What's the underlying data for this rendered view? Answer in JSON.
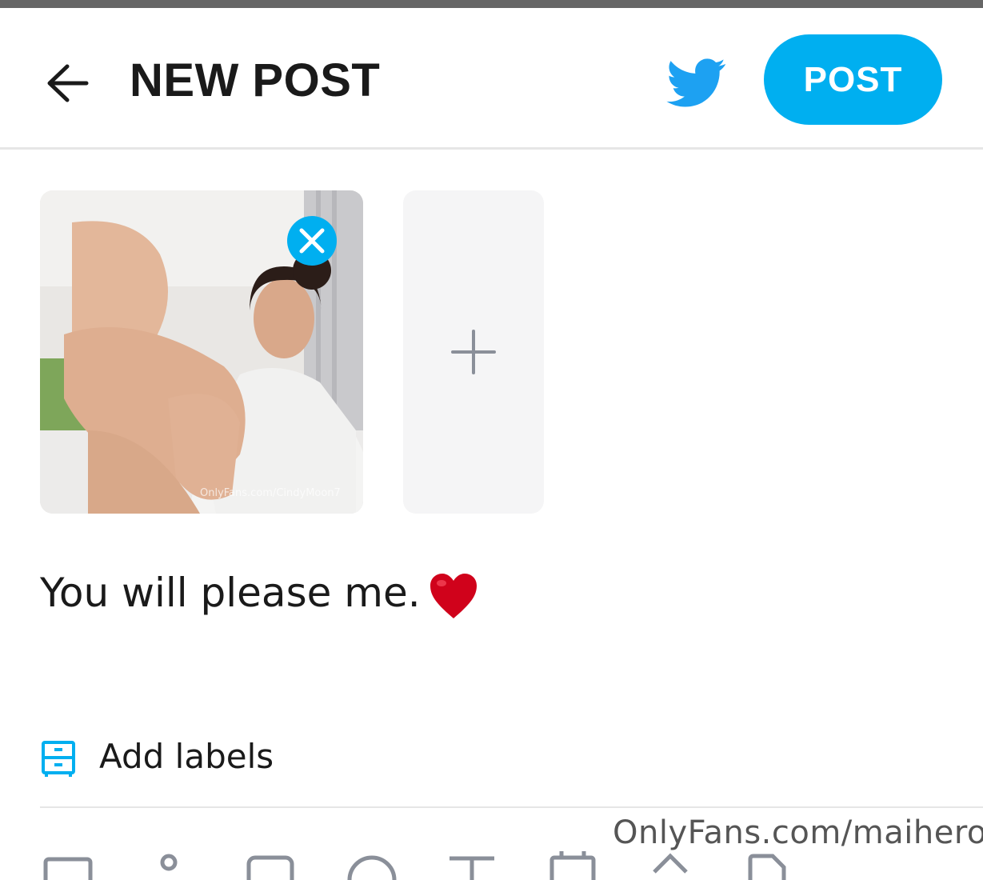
{
  "header": {
    "title": "NEW POST",
    "post_label": "POST"
  },
  "media": {
    "thumbnail_watermark": "OnlyFans.com/CindyMoon7"
  },
  "composer": {
    "text": "You will please me.",
    "emoji": "heart-emoji"
  },
  "labels": {
    "add_label": "Add labels"
  },
  "toolbar": {
    "icons": [
      "image-icon",
      "poll-icon",
      "message-icon",
      "emoji-icon",
      "quiz-icon",
      "calendar-icon",
      "tag-icon",
      "document-icon"
    ]
  },
  "watermark": "OnlyFans.com/maihero",
  "colors": {
    "accent": "#00aff0",
    "twitter": "#1da1f2",
    "text": "#1a1a1a",
    "divider": "#e6e6e6"
  }
}
